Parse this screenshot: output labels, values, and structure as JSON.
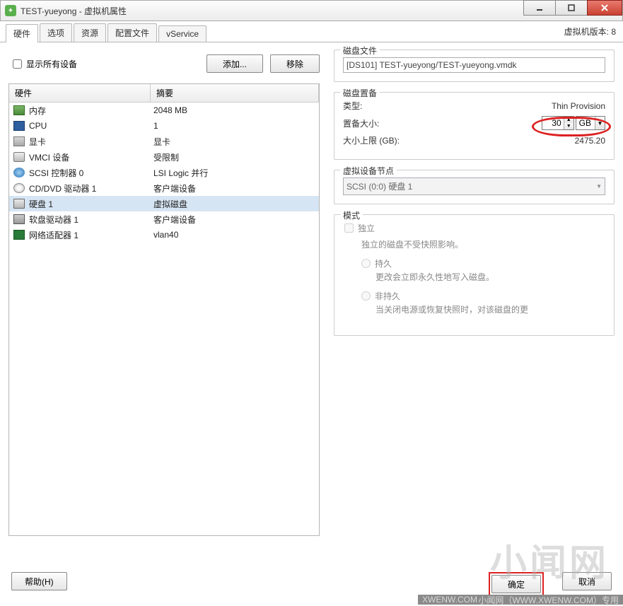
{
  "window": {
    "title": "TEST-yueyong - 虚拟机属性"
  },
  "tabs": [
    "硬件",
    "选项",
    "资源",
    "配置文件",
    "vService"
  ],
  "vm_version_label": "虚拟机版本: 8",
  "show_all_devices_label": "显示所有设备",
  "buttons": {
    "add": "添加...",
    "remove": "移除",
    "help": "帮助(H)",
    "ok": "确定",
    "cancel": "取消"
  },
  "hw_headers": {
    "hardware": "硬件",
    "summary": "摘要"
  },
  "hardware": [
    {
      "icon": "ic-mem",
      "name": "内存",
      "summary": "2048 MB"
    },
    {
      "icon": "ic-cpu",
      "name": "CPU",
      "summary": "1"
    },
    {
      "icon": "ic-vid",
      "name": "显卡",
      "summary": "显卡"
    },
    {
      "icon": "ic-vmci",
      "name": "VMCI 设备",
      "summary": "受限制"
    },
    {
      "icon": "ic-scsi",
      "name": "SCSI 控制器 0",
      "summary": "LSI Logic 并行"
    },
    {
      "icon": "ic-cd",
      "name": "CD/DVD 驱动器 1",
      "summary": "客户端设备"
    },
    {
      "icon": "ic-hdd",
      "name": "硬盘 1",
      "summary": "虚拟磁盘",
      "selected": true
    },
    {
      "icon": "ic-flp",
      "name": "软盘驱动器 1",
      "summary": "客户端设备"
    },
    {
      "icon": "ic-nic",
      "name": "网络适配器 1",
      "summary": "vlan40"
    }
  ],
  "disk_file": {
    "legend": "磁盘文件",
    "value": "[DS101] TEST-yueyong/TEST-yueyong.vmdk"
  },
  "disk_prov": {
    "legend": "磁盘置备",
    "type_label": "类型:",
    "type_value": "Thin Provision",
    "size_label": "置备大小:",
    "size_value": "30",
    "size_unit": "GB",
    "max_label": "大小上限 (GB):",
    "max_value": "2475.20"
  },
  "virt_node": {
    "legend": "虚拟设备节点",
    "value": "SCSI (0:0) 硬盘 1"
  },
  "mode": {
    "legend": "模式",
    "independent": "独立",
    "independent_desc": "独立的磁盘不受快照影响。",
    "persistent": "持久",
    "persistent_desc": "更改会立即永久性地写入磁盘。",
    "nonpersistent": "非持久",
    "nonpersistent_desc": "当关闭电源或恢复快照时，对该磁盘的更"
  },
  "watermark": "小闻网",
  "wm_bar_left": "XWENW.COM",
  "wm_bar_right": "小闻网（WWW.XWENW.COM）专用"
}
